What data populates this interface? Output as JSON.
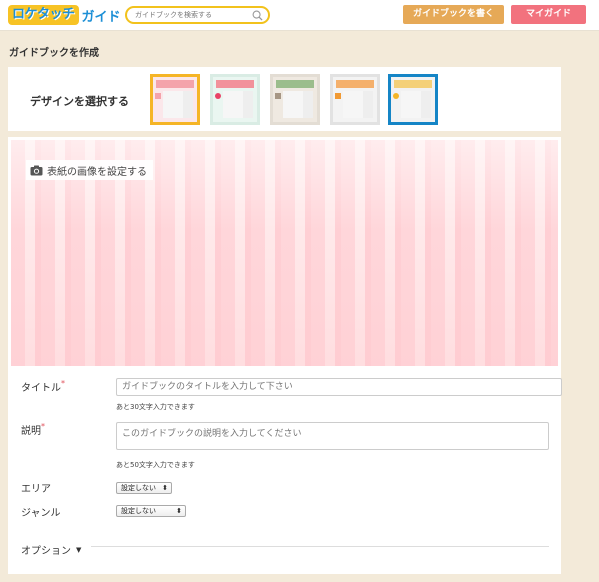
{
  "header": {
    "logo_mark": "ロケタッチ",
    "logo_sub": "ガイド",
    "search_placeholder": "ガイドブックを検索する",
    "write_button": "ガイドブックを書く",
    "my_button": "マイガイド",
    "colors": {
      "logo_yellow": "#f7c325",
      "logo_blue": "#1c8fd6",
      "write": "#e6a957",
      "my": "#f2727e"
    }
  },
  "page": {
    "title": "ガイドブックを作成"
  },
  "design": {
    "label": "デザインを選択する",
    "themes": [
      {
        "name": "pink",
        "bar": "#f4a3ab",
        "dot": "#f4a3ab",
        "bg": "#fbe7ea",
        "border": "#f5b526",
        "selected": true
      },
      {
        "name": "mint",
        "bar": "#f2929b",
        "dot": "#e94367",
        "bg": "#eaf6f1",
        "border": "#d9ece4",
        "selected": false
      },
      {
        "name": "green",
        "bar": "#9bbd8c",
        "dot": "#a69684",
        "bg": "#efe9e1",
        "border": "#e3ddd4",
        "selected": false
      },
      {
        "name": "orange",
        "bar": "#f4b06c",
        "dot": "#f19a34",
        "bg": "#f3f3f3",
        "border": "#e2e2e2",
        "selected": false
      },
      {
        "name": "blue",
        "bar": "#f4d078",
        "dot": "#f5b526",
        "bg": "#f2f2f2",
        "border": "#1585c6",
        "selected": false
      }
    ]
  },
  "cover": {
    "set_image_label": "表紙の画像を設定する"
  },
  "form": {
    "title_label": "タイトル",
    "title_placeholder": "ガイドブックのタイトルを入力して下さい",
    "title_note": "あと30文字入力できます",
    "desc_label": "説明",
    "desc_placeholder": "このガイドブックの説明を入力してください",
    "desc_note": "あと50文字入力できます",
    "area_label": "エリア",
    "area_value": "設定しない",
    "genre_label": "ジャンル",
    "genre_value": "設定しない",
    "option_label": "オプション"
  }
}
